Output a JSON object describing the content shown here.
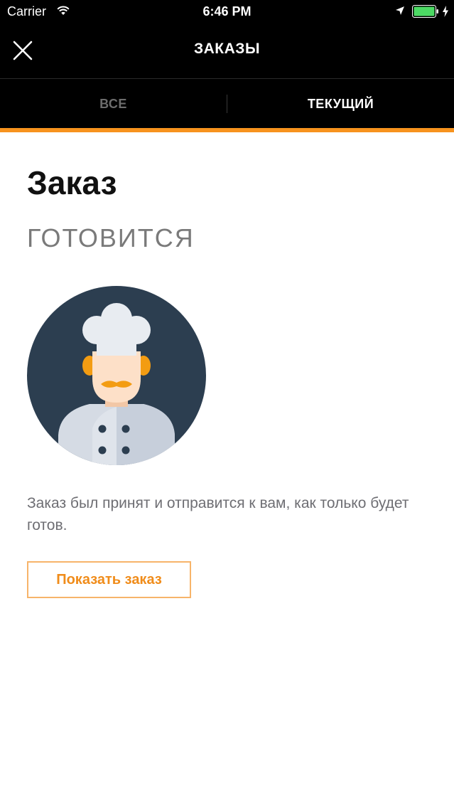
{
  "status_bar": {
    "carrier": "Carrier",
    "time": "6:46 PM"
  },
  "navbar": {
    "title": "ЗАКАЗЫ",
    "close_icon": "close-icon"
  },
  "tabs": [
    {
      "label": "ВСЕ",
      "active": false
    },
    {
      "label": "ТЕКУЩИЙ",
      "active": true
    }
  ],
  "order": {
    "title": "Заказ",
    "status": "ГОТОВИТСЯ",
    "message": "Заказ был принят и отправится к вам, как только будет готов.",
    "show_button_label": "Показать заказ"
  },
  "colors": {
    "accent": "#f7931e",
    "navbar_bg": "#000000",
    "illustration_bg": "#2c3e50"
  }
}
